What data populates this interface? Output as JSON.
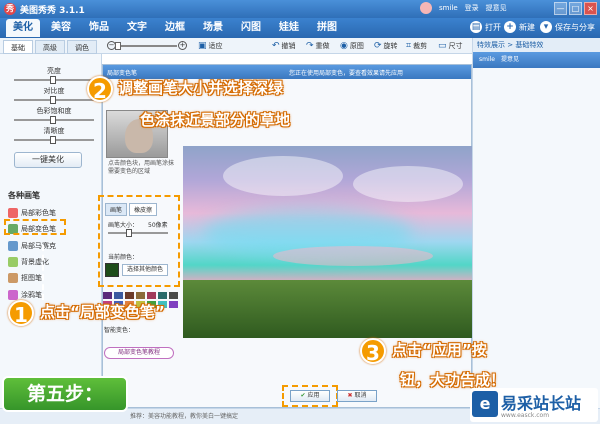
{
  "app": {
    "title": "美图秀秀 3.1.1",
    "logo": "秀",
    "user": "smile",
    "username2": "登录",
    "feedback": "提意见"
  },
  "window": {
    "min": "—",
    "max": "□",
    "close": "×"
  },
  "menu": {
    "tabs": [
      "美化",
      "美容",
      "饰品",
      "文字",
      "边框",
      "场景",
      "闪图",
      "娃娃",
      "拼图"
    ],
    "open": "打开",
    "new": "新建",
    "save": "保存与分享"
  },
  "toolbar": {
    "subtabs": [
      "基础",
      "高级",
      "调色"
    ],
    "fit": "适应",
    "tools": [
      "撤销",
      "重做",
      "原图",
      "旋转",
      "裁剪",
      "尺寸"
    ]
  },
  "left": {
    "sliders": [
      "亮度",
      "对比度",
      "色彩饱和度",
      "清晰度"
    ],
    "onekey": "一键美化",
    "section": "各种画笔",
    "brushes": [
      "局部彩色笔",
      "局部变色笔",
      "局部马赛克",
      "背景虚化",
      "抠图笔",
      "涂鸦笔"
    ]
  },
  "dialog": {
    "title": "局部变色笔",
    "tip": "您正在使用局部变色，要查看效果请先应用",
    "desc": "点击颜色块，用画笔涂抹需要变色的区域",
    "mode_paint": "画笔",
    "mode_erase": "橡皮擦",
    "brush_size_label": "画笔大小：",
    "brush_size_value": "50像素",
    "current_color": "当前颜色：",
    "other_color": "选择其他颜色",
    "hint": "智能变色：",
    "tutorial": "局部变色笔教程",
    "apply": "应用",
    "cancel": "取消"
  },
  "right": {
    "head": "特效展示 > 基础特效",
    "user": "smile",
    "feedback": "提意见"
  },
  "status": {
    "text": "推荐：美容功能教程，教你美白一键搞定"
  },
  "annotations": {
    "step2_num": "2",
    "step2_line1": "调整画笔大小并选择深绿",
    "step2_line2": "色涂抹近景部分的草地",
    "step1_num": "1",
    "step1_text": "点击“局部变色笔”",
    "step3_num": "3",
    "step3_line1": "点击“应用”按",
    "step3_line2": "钮，大功告成！",
    "step_label": "第五步："
  },
  "brand": {
    "logo": "e",
    "name": "易采站长站",
    "url": "www.easck.com"
  },
  "colors": {
    "title_blue": "#2f6fb8",
    "accent_orange": "#f59b00",
    "step_green": "#36952a",
    "current_swatch": "#1e4d1a"
  }
}
